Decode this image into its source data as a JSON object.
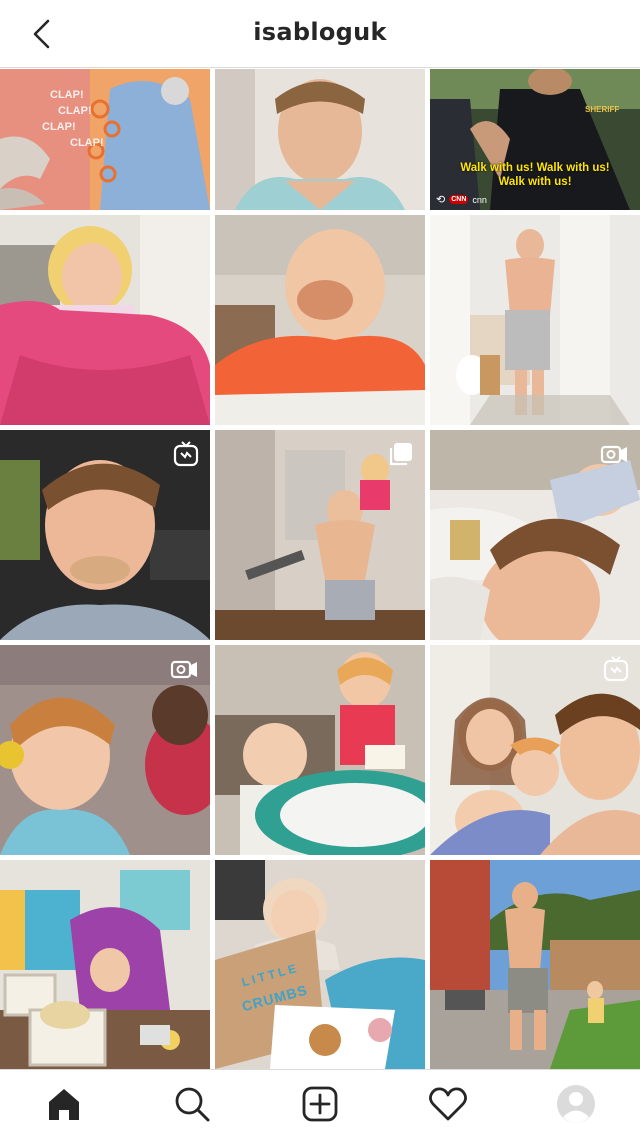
{
  "header": {
    "title": "isabloguk",
    "back_icon": "chevron-left-icon"
  },
  "grid": {
    "posts": [
      {
        "id": 1,
        "type": "image",
        "clap_text": [
          "CLAP!",
          "CLAP!",
          "CLAP!",
          "CLAP!"
        ]
      },
      {
        "id": 2,
        "type": "image"
      },
      {
        "id": 3,
        "type": "image",
        "caption": "Walk with us! Walk with us! Walk with us!",
        "source": "cnn",
        "source_badge": "CNN",
        "sign_text": "SHERIFF"
      },
      {
        "id": 4,
        "type": "image"
      },
      {
        "id": 5,
        "type": "image"
      },
      {
        "id": 6,
        "type": "image"
      },
      {
        "id": 7,
        "type": "igtv",
        "badge": "igtv-icon"
      },
      {
        "id": 8,
        "type": "carousel",
        "badge": "carousel-icon"
      },
      {
        "id": 9,
        "type": "video",
        "badge": "video-camera-icon"
      },
      {
        "id": 10,
        "type": "video",
        "badge": "video-camera-icon"
      },
      {
        "id": 11,
        "type": "image"
      },
      {
        "id": 12,
        "type": "igtv",
        "badge": "igtv-icon"
      },
      {
        "id": 13,
        "type": "image"
      },
      {
        "id": 14,
        "type": "image",
        "box_text_1": "LITTLE",
        "box_text_2": "CRUMBS"
      },
      {
        "id": 15,
        "type": "image"
      }
    ]
  },
  "bottom_nav": {
    "items": [
      {
        "name": "home",
        "icon": "home-icon",
        "active": true
      },
      {
        "name": "search",
        "icon": "search-icon"
      },
      {
        "name": "new-post",
        "icon": "plus-square-icon"
      },
      {
        "name": "activity",
        "icon": "heart-icon"
      },
      {
        "name": "profile",
        "icon": "avatar-icon"
      }
    ]
  },
  "colors": {
    "text": "#262626",
    "divider": "#dbdbdb",
    "background": "#ffffff",
    "caption_yellow": "#ffe600"
  }
}
